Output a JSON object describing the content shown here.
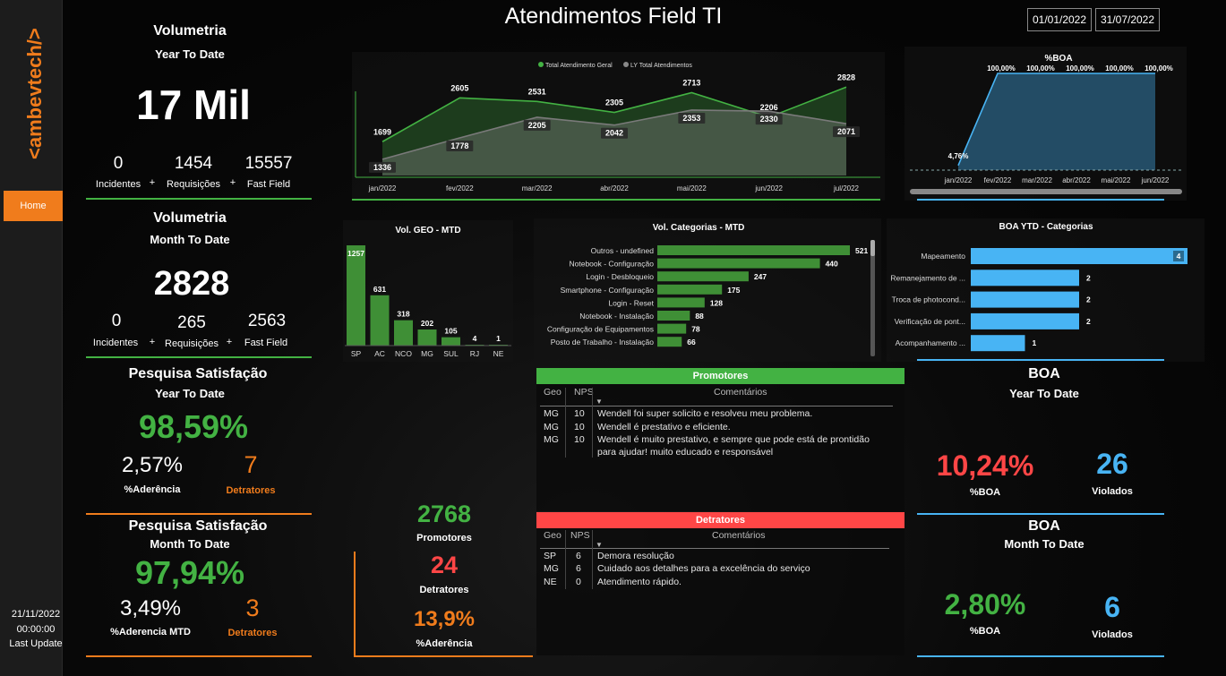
{
  "sidebar": {
    "logo_text": "<ambevtech/>",
    "home_label": "Home",
    "update_date": "21/11/2022",
    "update_time": "00:00:00",
    "update_label": "Last Update"
  },
  "header": {
    "title": "Atendimentos Field TI",
    "date_start": "01/01/2022",
    "date_end": "31/07/2022"
  },
  "vol_ytd": {
    "title": "Volumetria",
    "subtitle": "Year To Date",
    "big": "17 Mil",
    "incidentes_value": "0",
    "incidentes_label": "Incidentes",
    "requisicoes_value": "1454",
    "requisicoes_label": "Requisições",
    "fastfield_value": "15557",
    "fastfield_label": "Fast Field",
    "plus": "+"
  },
  "vol_mtd": {
    "title": "Volumetria",
    "subtitle": "Month To Date",
    "big": "2828",
    "incidentes_value": "0",
    "incidentes_label": "Incidentes",
    "requisicoes_value": "265",
    "requisicoes_label": "Requisições",
    "fastfield_value": "2563",
    "fastfield_label": "Fast Field",
    "plus": "+"
  },
  "sat_ytd": {
    "title": "Pesquisa Satisfação",
    "subtitle": "Year To Date",
    "big": "98,59%",
    "aderencia_value": "2,57%",
    "aderencia_label": "%Aderência",
    "detratores_value": "7",
    "detratores_label": "Detratores"
  },
  "sat_mtd": {
    "title": "Pesquisa Satisfação",
    "subtitle": "Month To Date",
    "big": "97,94%",
    "aderencia_value": "3,49%",
    "aderencia_label": "%Aderencia MTD",
    "detratores_value": "3",
    "detratores_label": "Detratores"
  },
  "mid_kpis": {
    "promotores_value": "2768",
    "promotores_label": "Promotores",
    "detratores_value": "24",
    "detratores_label": "Detratores",
    "aderencia_value": "13,9%",
    "aderencia_label": "%Aderência"
  },
  "boa_ytd": {
    "title": "BOA",
    "subtitle": "Year To Date",
    "boa_value": "10,24%",
    "boa_label": "%BOA",
    "violados_value": "26",
    "violados_label": "Violados"
  },
  "boa_mtd": {
    "title": "BOA",
    "subtitle": "Month To Date",
    "boa_value": "2,80%",
    "boa_label": "%BOA",
    "violados_value": "6",
    "violados_label": "Violados"
  },
  "promotores_table": {
    "title": "Promotores",
    "col_geo": "Geo",
    "col_nps": "NPS",
    "col_comentarios": "Comentários",
    "rows": [
      {
        "geo": "MG",
        "nps": "10",
        "comment": "Wendell foi super solicito e resolveu meu problema."
      },
      {
        "geo": "MG",
        "nps": "10",
        "comment": "Wendell é prestativo e eficiente."
      },
      {
        "geo": "MG",
        "nps": "10",
        "comment": "Wendell é muito prestativo, e sempre que pode está de prontidão",
        "comment2": "para ajudar! muito educado e responsável"
      }
    ]
  },
  "detratores_table": {
    "title": "Detratores",
    "col_geo": "Geo",
    "col_nps": "NPS",
    "col_comentarios": "Comentários",
    "rows": [
      {
        "geo": "SP",
        "nps": "6",
        "comment": "Demora resolução"
      },
      {
        "geo": "MG",
        "nps": "6",
        "comment": "Cuidado aos detalhes para a excelência do serviço"
      },
      {
        "geo": "NE",
        "nps": "0",
        "comment": "Atendimento rápido."
      }
    ]
  },
  "colors": {
    "green": "#43b243",
    "red": "#ff4646",
    "orange": "#f07c1c",
    "blue": "#48b4f4"
  },
  "chart_data": [
    {
      "type": "area",
      "legend": [
        "Total Atendimento Geral",
        "LY Total Atendimentos"
      ],
      "legend_position": "top-center",
      "categories": [
        "jan/2022",
        "fev/2022",
        "mar/2022",
        "abr/2022",
        "mai/2022",
        "jun/2022",
        "jul/2022"
      ],
      "series": [
        {
          "name": "Total Atendimento Geral",
          "values": [
            1699,
            2605,
            2531,
            2305,
            2713,
            2206,
            2828
          ]
        },
        {
          "name": "LY Total Atendimentos",
          "values": [
            1336,
            1778,
            2205,
            2042,
            2353,
            2330,
            2071
          ]
        }
      ],
      "ylim": [
        1000,
        3000
      ],
      "grid": false
    },
    {
      "type": "area",
      "title": "%BOA",
      "categories": [
        "jan/2022",
        "fev/2022",
        "mar/2022",
        "abr/2022",
        "mai/2022",
        "jun/2022"
      ],
      "values": [
        4.76,
        100,
        100,
        100,
        100,
        100
      ],
      "labels": [
        "4,76%",
        "100,00%",
        "100,00%",
        "100,00%",
        "100,00%",
        "100,00%"
      ],
      "ylim": [
        0,
        100
      ]
    },
    {
      "type": "bar",
      "title": "Vol. GEO - MTD",
      "categories": [
        "SP",
        "AC",
        "NCO",
        "MG",
        "SUL",
        "RJ",
        "NE"
      ],
      "values": [
        1257,
        631,
        318,
        202,
        105,
        4,
        1
      ]
    },
    {
      "type": "bar",
      "title": "Vol. Categorias - MTD",
      "orientation": "horizontal",
      "categories": [
        "Outros - undefined",
        "Notebook - Configuração",
        "Login - Desbloqueio",
        "Smartphone - Configuração",
        "Login - Reset",
        "Notebook - Instalação",
        "Configuração de Equipamentos",
        "Posto de Trabalho - Instalação"
      ],
      "values": [
        521,
        440,
        247,
        175,
        128,
        88,
        78,
        66
      ]
    },
    {
      "type": "bar",
      "title": "BOA YTD - Categorias",
      "orientation": "horizontal",
      "categories": [
        "Mapeamento",
        "Remanejamento de ...",
        "Troca de photocond...",
        "Verificação de pont...",
        "Acompanhamento ..."
      ],
      "values": [
        4,
        2,
        2,
        2,
        1
      ]
    }
  ]
}
